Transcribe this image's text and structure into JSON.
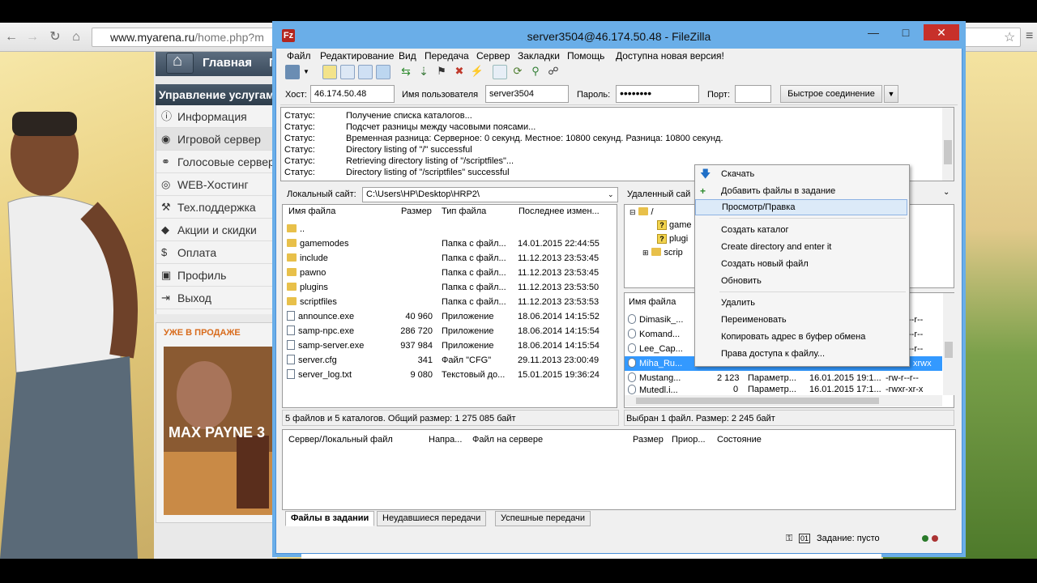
{
  "browser": {
    "url_domain": "www.myarena.ru",
    "url_path": "/home.php?m",
    "back_icon": "back-arrow-icon",
    "forward_icon": "forward-arrow-icon",
    "reload_icon": "reload-icon",
    "home_icon": "home-icon"
  },
  "site": {
    "nav_label": "Главная",
    "nav_next": "П",
    "services_heading": "Управление услугами",
    "menu": [
      {
        "icon": "info-icon",
        "label": "Информация"
      },
      {
        "icon": "gamepad-icon",
        "label": "Игровой сервер"
      },
      {
        "icon": "headset-icon",
        "label": "Голосовые сервера"
      },
      {
        "icon": "globe-icon",
        "label": "WEB-Хостинг"
      },
      {
        "icon": "wrench-icon",
        "label": "Тех.поддержка"
      },
      {
        "icon": "tag-icon",
        "label": "Акции и скидки"
      },
      {
        "icon": "dollar-icon",
        "label": "Оплата"
      },
      {
        "icon": "folder-icon",
        "label": "Профиль"
      },
      {
        "icon": "logout-icon",
        "label": "Выход"
      }
    ],
    "sale_heading": "УЖЕ В ПРОДАЖЕ",
    "promo_title": "MAX PAYNE 3"
  },
  "filezilla": {
    "title": "server3504@46.174.50.48 - FileZilla",
    "menu": [
      "Файл",
      "Редактирование",
      "Вид",
      "Передача",
      "Сервер",
      "Закладки",
      "Помощь",
      "Доступна новая версия!"
    ],
    "quickconnect": {
      "host_label": "Хост:",
      "host_value": "46.174.50.48",
      "user_label": "Имя пользователя",
      "user_value": "server3504",
      "pass_label": "Пароль:",
      "pass_value": "••••••••",
      "port_label": "Порт:",
      "port_value": "",
      "button": "Быстрое соединение"
    },
    "log": [
      {
        "k": "Статус:",
        "v": "Получение списка каталогов..."
      },
      {
        "k": "Статус:",
        "v": "Подсчет разницы между часовыми поясами..."
      },
      {
        "k": "Статус:",
        "v": "Временная разница: Серверное: 0 секунд. Местное: 10800 секунд. Разница: 10800 секунд."
      },
      {
        "k": "Статус:",
        "v": "Directory listing of \"/\" successful"
      },
      {
        "k": "Статус:",
        "v": "Retrieving directory listing of \"/scriptfiles\"..."
      },
      {
        "k": "Статус:",
        "v": "Directory listing of \"/scriptfiles\" successful"
      }
    ],
    "local": {
      "site_label": "Локальный сайт:",
      "path": "C:\\Users\\HP\\Desktop\\HRP2\\",
      "headers": [
        "Имя файла",
        "Размер",
        "Тип файла",
        "Последнее измен..."
      ],
      "rows": [
        {
          "name": "..",
          "size": "",
          "type": "",
          "date": "",
          "kind": "folder"
        },
        {
          "name": "gamemodes",
          "size": "",
          "type": "Папка с файл...",
          "date": "14.01.2015 22:44:55",
          "kind": "folder"
        },
        {
          "name": "include",
          "size": "",
          "type": "Папка с файл...",
          "date": "11.12.2013 23:53:45",
          "kind": "folder"
        },
        {
          "name": "pawno",
          "size": "",
          "type": "Папка с файл...",
          "date": "11.12.2013 23:53:45",
          "kind": "folder"
        },
        {
          "name": "plugins",
          "size": "",
          "type": "Папка с файл...",
          "date": "11.12.2013 23:53:50",
          "kind": "folder"
        },
        {
          "name": "scriptfiles",
          "size": "",
          "type": "Папка с файл...",
          "date": "11.12.2013 23:53:53",
          "kind": "folder"
        },
        {
          "name": "announce.exe",
          "size": "40 960",
          "type": "Приложение",
          "date": "18.06.2014 14:15:52",
          "kind": "file"
        },
        {
          "name": "samp-npc.exe",
          "size": "286 720",
          "type": "Приложение",
          "date": "18.06.2014 14:15:54",
          "kind": "file"
        },
        {
          "name": "samp-server.exe",
          "size": "937 984",
          "type": "Приложение",
          "date": "18.06.2014 14:15:54",
          "kind": "file"
        },
        {
          "name": "server.cfg",
          "size": "341",
          "type": "Файл \"CFG\"",
          "date": "29.11.2013 23:00:49",
          "kind": "file"
        },
        {
          "name": "server_log.txt",
          "size": "9 080",
          "type": "Текстовый до...",
          "date": "15.01.2015 19:36:24",
          "kind": "file"
        }
      ],
      "status": "5 файлов и 5 каталогов. Общий размер: 1 275 085 байт"
    },
    "remote": {
      "site_label": "Удаленный сай",
      "tree": [
        {
          "label": "/"
        },
        {
          "label": "game"
        },
        {
          "label": "plugi"
        },
        {
          "label": "scrip"
        }
      ],
      "header_name": "Имя файла",
      "rows": [
        {
          "name": "Dimasik_...",
          "size": "",
          "type": "",
          "date": "",
          "perm": "--r--"
        },
        {
          "name": "Komand...",
          "size": "",
          "type": "",
          "date": "",
          "perm": "--r--"
        },
        {
          "name": "Lee_Cap...",
          "size": "",
          "type": "",
          "date": "",
          "perm": "--r--"
        },
        {
          "name": "Miha_Ru...",
          "size": "",
          "type": "",
          "date": "",
          "perm": "xrwx"
        },
        {
          "name": "Mustang...",
          "size": "2 123",
          "type": "Параметр...",
          "date": "16.01.2015 19:1...",
          "perm": "-rw-r--r--"
        },
        {
          "name": "Mutedl.i...",
          "size": "0",
          "type": "Параметр...",
          "date": "16.01.2015 17:1...",
          "perm": "-rwxr-xr-x"
        }
      ],
      "status": "Выбран 1 файл. Размер: 2 245 байт"
    },
    "queue_headers": [
      "Сервер/Локальный файл",
      "Напра...",
      "Файл на сервере",
      "Размер",
      "Приор...",
      "Состояние"
    ],
    "tabs": [
      "Файлы в задании",
      "Неудавшиеся передачи",
      "Успешные передачи"
    ],
    "queue_status": "Задание: пусто",
    "context_menu": [
      {
        "label": "Скачать",
        "icon": "download-arrow-icon"
      },
      {
        "label": "Добавить файлы в задание",
        "icon": "add-queue-icon"
      },
      {
        "label": "Просмотр/Правка",
        "icon": ""
      },
      {
        "label": "Создать каталог",
        "icon": ""
      },
      {
        "label": "Create directory and enter it",
        "icon": ""
      },
      {
        "label": "Создать новый файл",
        "icon": ""
      },
      {
        "label": "Обновить",
        "icon": ""
      },
      {
        "label": "Удалить",
        "icon": ""
      },
      {
        "label": "Переименовать",
        "icon": ""
      },
      {
        "label": "Копировать адрес в буфер обмена",
        "icon": ""
      },
      {
        "label": "Права доступа к файлу...",
        "icon": ""
      }
    ]
  },
  "colors": {
    "title_bar": "#6aaee8",
    "close_button": "#c7302a",
    "sale_heading": "#d86b1c",
    "selection": "#3399ff"
  }
}
